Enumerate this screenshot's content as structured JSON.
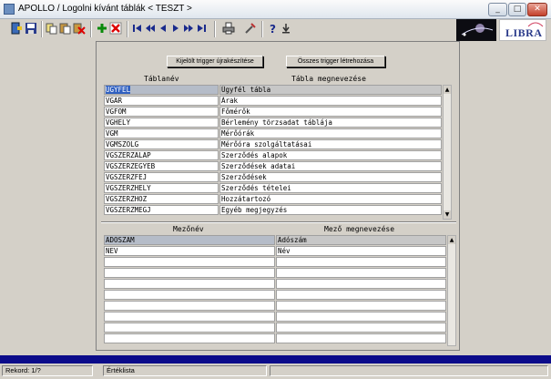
{
  "window": {
    "title": "APOLLO / Logolni kívánt táblák  < TESZT >",
    "minimize": "_",
    "maximize": "□",
    "close": "✕"
  },
  "toolbar": {
    "icons": [
      "exit-icon",
      "save-icon",
      "copy-icon",
      "paste-icon",
      "delete-record-icon",
      "add-row-icon",
      "remove-row-icon",
      "first-record-icon",
      "prev-page-icon",
      "prev-record-icon",
      "next-record-icon",
      "next-page-icon",
      "last-record-icon",
      "print-icon",
      "tools-icon",
      "help-icon",
      "info-icon"
    ]
  },
  "buttons": {
    "rebuild_selected": "Kijelölt trigger újrakészítése",
    "create_all": "Összes trigger létrehozása"
  },
  "tables_grid": {
    "headers": [
      "Táblanév",
      "Tábla megnevezése"
    ],
    "rows": [
      {
        "name": "UGYFEL",
        "desc": "Ügyfél tábla"
      },
      {
        "name": "VGAR",
        "desc": "Árak"
      },
      {
        "name": "VGFOM",
        "desc": "Főmérők"
      },
      {
        "name": "VGHELY",
        "desc": "Bérlemény törzsadat táblája"
      },
      {
        "name": "VGM",
        "desc": "Mérőórák"
      },
      {
        "name": "VGMSZOLG",
        "desc": "Mérőóra szolgáltatásai"
      },
      {
        "name": "VGSZERZALAP",
        "desc": "Szerződés alapok"
      },
      {
        "name": "VGSZERZEGYEB",
        "desc": "Szerződések adatai"
      },
      {
        "name": "VGSZERZFEJ",
        "desc": "Szerződések"
      },
      {
        "name": "VGSZERZHELY",
        "desc": "Szerződés tételei"
      },
      {
        "name": "VGSZERZHOZ",
        "desc": "Hozzátartozó"
      },
      {
        "name": "VGSZERZMEGJ",
        "desc": "Egyéb megjegyzés"
      }
    ]
  },
  "fields_grid": {
    "headers": [
      "Mezőnév",
      "Mező megnevezése"
    ],
    "rows": [
      {
        "name": "ADOSZAM",
        "desc": "Adószám"
      },
      {
        "name": "NEV",
        "desc": "Név"
      },
      {
        "name": "",
        "desc": ""
      },
      {
        "name": "",
        "desc": ""
      },
      {
        "name": "",
        "desc": ""
      },
      {
        "name": "",
        "desc": ""
      },
      {
        "name": "",
        "desc": ""
      },
      {
        "name": "",
        "desc": ""
      },
      {
        "name": "",
        "desc": ""
      },
      {
        "name": "",
        "desc": ""
      }
    ]
  },
  "statusbar": {
    "record": "Rekord: 1/?",
    "mode": "Értéklista"
  },
  "logos": {
    "right": "LIBRA"
  },
  "colors": {
    "highlight": "#3060c0",
    "bluebar": "#0b0b8a"
  }
}
